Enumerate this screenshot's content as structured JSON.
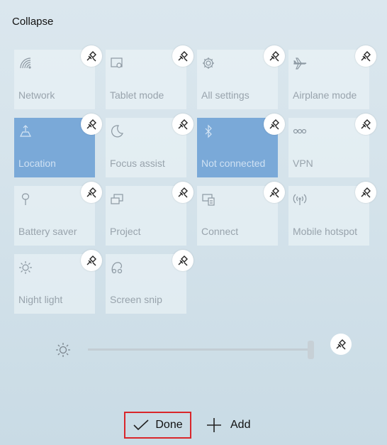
{
  "header": {
    "collapse_label": "Collapse"
  },
  "tiles": [
    {
      "label": "Network",
      "icon": "network-icon",
      "active": false
    },
    {
      "label": "Tablet mode",
      "icon": "tablet-mode-icon",
      "active": false
    },
    {
      "label": "All settings",
      "icon": "gear-icon",
      "active": false
    },
    {
      "label": "Airplane mode",
      "icon": "airplane-icon",
      "active": false
    },
    {
      "label": "Location",
      "icon": "location-icon",
      "active": true
    },
    {
      "label": "Focus assist",
      "icon": "moon-icon",
      "active": false
    },
    {
      "label": "Not connected",
      "icon": "bluetooth-icon",
      "active": true
    },
    {
      "label": "VPN",
      "icon": "vpn-icon",
      "active": false
    },
    {
      "label": "Battery saver",
      "icon": "battery-saver-icon",
      "active": false
    },
    {
      "label": "Project",
      "icon": "project-icon",
      "active": false
    },
    {
      "label": "Connect",
      "icon": "connect-icon",
      "active": false
    },
    {
      "label": "Mobile hotspot",
      "icon": "hotspot-icon",
      "active": false
    },
    {
      "label": "Night light",
      "icon": "night-light-icon",
      "active": false
    },
    {
      "label": "Screen snip",
      "icon": "screen-snip-icon",
      "active": false
    }
  ],
  "brightness": {
    "icon": "sun-icon",
    "level": 1.0
  },
  "footer": {
    "done_label": "Done",
    "add_label": "Add"
  },
  "colors": {
    "active_tile": "#7aa9d8",
    "highlight_border": "#d9262b"
  }
}
